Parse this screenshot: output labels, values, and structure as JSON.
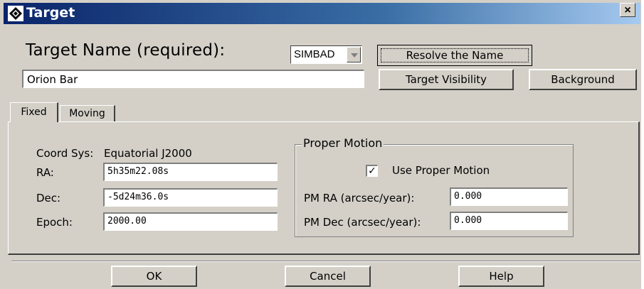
{
  "window": {
    "title": "Target",
    "close_label": "×"
  },
  "target": {
    "label": "Target Name (required):",
    "name_value": "Orion Bar",
    "resolver_selected": "SIMBAD",
    "resolve_button": "Resolve the Name",
    "visibility_button": "Target Visibility",
    "background_button": "Background"
  },
  "tabs": [
    {
      "label": "Fixed",
      "selected": true
    },
    {
      "label": "Moving",
      "selected": false
    }
  ],
  "fixed": {
    "coord_sys_label": "Coord Sys:",
    "coord_sys_value": "Equatorial J2000",
    "ra_label": "RA:",
    "ra_value": "5h35m22.08s",
    "dec_label": "Dec:",
    "dec_value": "-5d24m36.0s",
    "epoch_label": "Epoch:",
    "epoch_value": "2000.00"
  },
  "proper_motion": {
    "group_title": "Proper Motion",
    "use_label": "Use Proper Motion",
    "use_checked": true,
    "check_mark": "✓",
    "pm_ra_label": "PM RA (arcsec/year):",
    "pm_ra_value": "0.000",
    "pm_dec_label": "PM Dec (arcsec/year):",
    "pm_dec_value": "0.000"
  },
  "footer": {
    "ok": "OK",
    "cancel": "Cancel",
    "help": "Help"
  },
  "colors": {
    "titlebar_start": "#0a246a",
    "titlebar_end": "#a6caf0",
    "face": "#d4d0c8"
  }
}
